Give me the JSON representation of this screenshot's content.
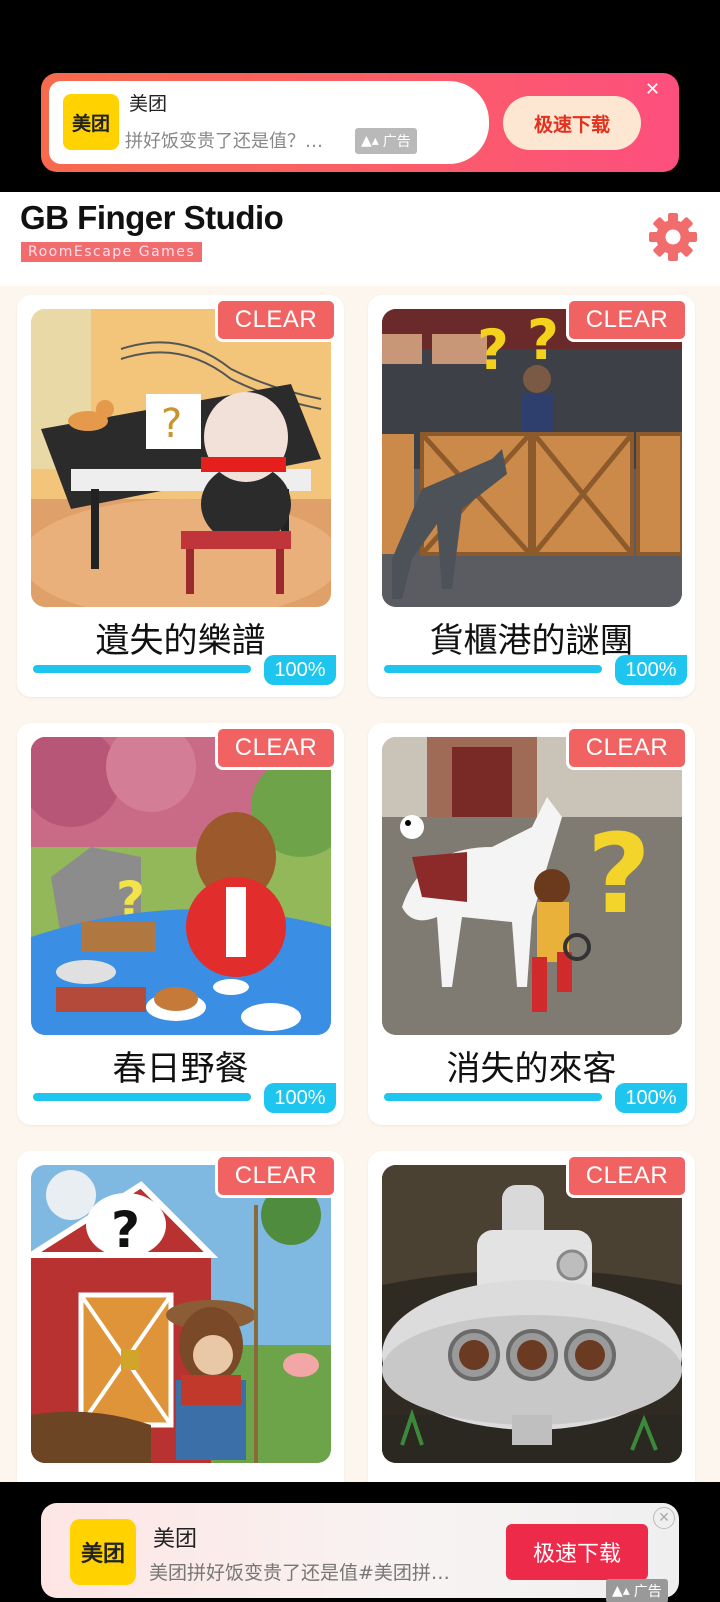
{
  "ad_top": {
    "brand": "美团",
    "logo_text": "美团",
    "desc": "拼好饭变贵了还是值？…",
    "ad_label": "广告",
    "download_label": "极速下载",
    "close_glyph": "✕"
  },
  "header": {
    "title": "GB Finger Studio",
    "subtitle": "RoomEscape  Games",
    "settings_icon": "gear-icon",
    "accent_color": "#f16d6d"
  },
  "games": [
    {
      "title": "遺失的樂譜",
      "badge": "CLEAR",
      "progress": 100,
      "progress_label": "100%",
      "scene": "piano"
    },
    {
      "title": "貨櫃港的謎團",
      "badge": "CLEAR",
      "progress": 100,
      "progress_label": "100%",
      "scene": "crates"
    },
    {
      "title": "春日野餐",
      "badge": "CLEAR",
      "progress": 100,
      "progress_label": "100%",
      "scene": "picnic"
    },
    {
      "title": "消失的來客",
      "badge": "CLEAR",
      "progress": 100,
      "progress_label": "100%",
      "scene": "horse"
    },
    {
      "title": "",
      "badge": "CLEAR",
      "scene": "farm"
    },
    {
      "title": "",
      "badge": "CLEAR",
      "scene": "submarine"
    }
  ],
  "ad_bottom": {
    "brand": "美团",
    "logo_text": "美团",
    "desc": "美团拼好饭变贵了还是值#美团拼…",
    "download_label": "极速下载",
    "ad_label": "广告",
    "close_glyph": "✕"
  },
  "colors": {
    "clear_badge": "#f16363",
    "progress": "#1dc5ef",
    "background": "#fdf6ef"
  }
}
